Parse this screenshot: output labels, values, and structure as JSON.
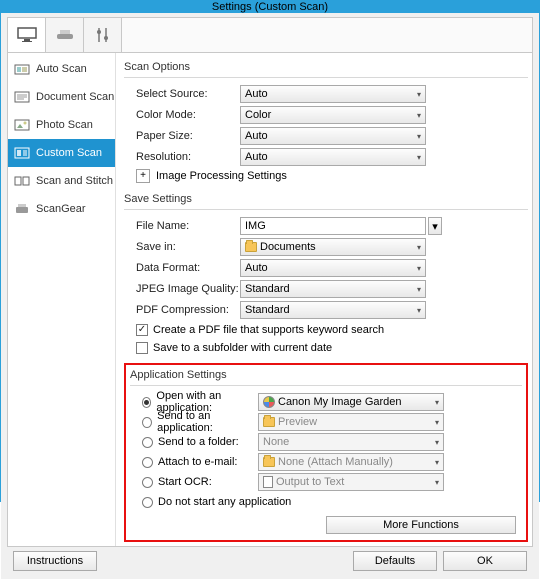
{
  "window": {
    "title": "Settings (Custom Scan)"
  },
  "sidebar": {
    "items": [
      {
        "label": "Auto Scan"
      },
      {
        "label": "Document Scan"
      },
      {
        "label": "Photo Scan"
      },
      {
        "label": "Custom Scan"
      },
      {
        "label": "Scan and Stitch"
      },
      {
        "label": "ScanGear"
      }
    ]
  },
  "scan_options": {
    "title": "Scan Options",
    "select_source_label": "Select Source:",
    "select_source_value": "Auto",
    "color_mode_label": "Color Mode:",
    "color_mode_value": "Color",
    "paper_size_label": "Paper Size:",
    "paper_size_value": "Auto",
    "resolution_label": "Resolution:",
    "resolution_value": "Auto",
    "image_processing_label": "Image Processing Settings"
  },
  "save_settings": {
    "title": "Save Settings",
    "file_name_label": "File Name:",
    "file_name_value": "IMG",
    "save_in_label": "Save in:",
    "save_in_value": "Documents",
    "data_format_label": "Data Format:",
    "data_format_value": "Auto",
    "jpeg_quality_label": "JPEG Image Quality:",
    "jpeg_quality_value": "Standard",
    "pdf_compression_label": "PDF Compression:",
    "pdf_compression_value": "Standard",
    "create_pdf_keyword_label": "Create a PDF file that supports keyword search",
    "save_subfolder_label": "Save to a subfolder with current date"
  },
  "app_settings": {
    "title": "Application Settings",
    "open_with_label": "Open with an application:",
    "open_with_value": "Canon My Image Garden",
    "send_app_label": "Send to an application:",
    "send_app_value": "Preview",
    "send_folder_label": "Send to a folder:",
    "send_folder_value": "None",
    "attach_email_label": "Attach to e-mail:",
    "attach_email_value": "None (Attach Manually)",
    "start_ocr_label": "Start OCR:",
    "start_ocr_value": "Output to Text",
    "do_not_start_label": "Do not start any application",
    "more_functions_label": "More Functions"
  },
  "footer": {
    "instructions": "Instructions",
    "defaults": "Defaults",
    "ok": "OK"
  }
}
